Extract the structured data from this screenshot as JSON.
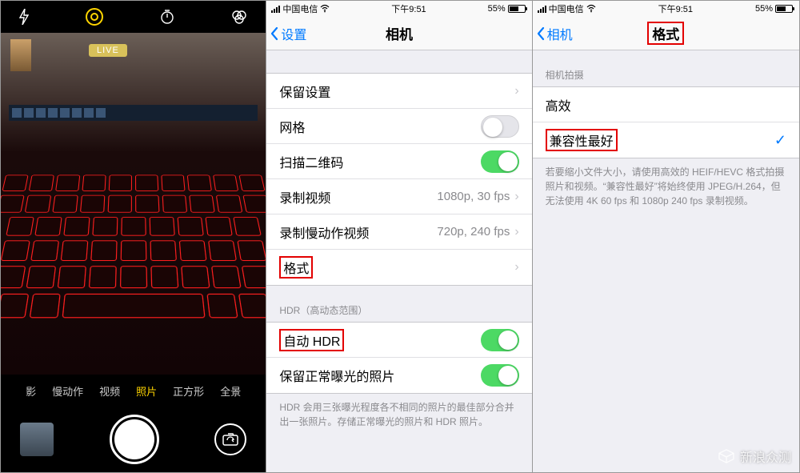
{
  "camera": {
    "live_badge": "LIVE",
    "modes": [
      "影",
      "慢动作",
      "视频",
      "照片",
      "正方形",
      "全景"
    ],
    "active_mode_index": 3,
    "top_icons": [
      "flash-icon",
      "live-photo-icon",
      "timer-icon",
      "filters-icon"
    ]
  },
  "status": {
    "carrier": "中国电信",
    "time": "下午9:51",
    "battery_pct": "55%"
  },
  "settings_camera": {
    "back_label": "设置",
    "title": "相机",
    "rows": {
      "keep_settings": "保留设置",
      "grid": "网格",
      "scan_qr": "扫描二维码",
      "record_video": "录制视频",
      "record_video_val": "1080p, 30 fps",
      "record_slomo": "录制慢动作视频",
      "record_slomo_val": "720p, 240 fps",
      "formats": "格式"
    },
    "hdr_header": "HDR（高动态范围）",
    "auto_hdr": "自动 HDR",
    "keep_normal": "保留正常曝光的照片",
    "hdr_footnote": "HDR 会用三张曝光程度各不相同的照片的最佳部分合并出一张照片。存储正常曝光的照片和 HDR 照片。",
    "toggles": {
      "grid": false,
      "scan_qr": true,
      "auto_hdr": true,
      "keep_normal": true
    }
  },
  "settings_format": {
    "back_label": "相机",
    "title": "格式",
    "section_header": "相机拍摄",
    "high_efficiency": "高效",
    "most_compatible": "兼容性最好",
    "selected": "most_compatible",
    "footnote": "若要缩小文件大小，请使用高效的 HEIF/HEVC 格式拍摄照片和视频。“兼容性最好”将始终使用 JPEG/H.264，但无法使用 4K 60 fps 和 1080p 240 fps 录制视频。"
  },
  "watermark": "新浪众测"
}
